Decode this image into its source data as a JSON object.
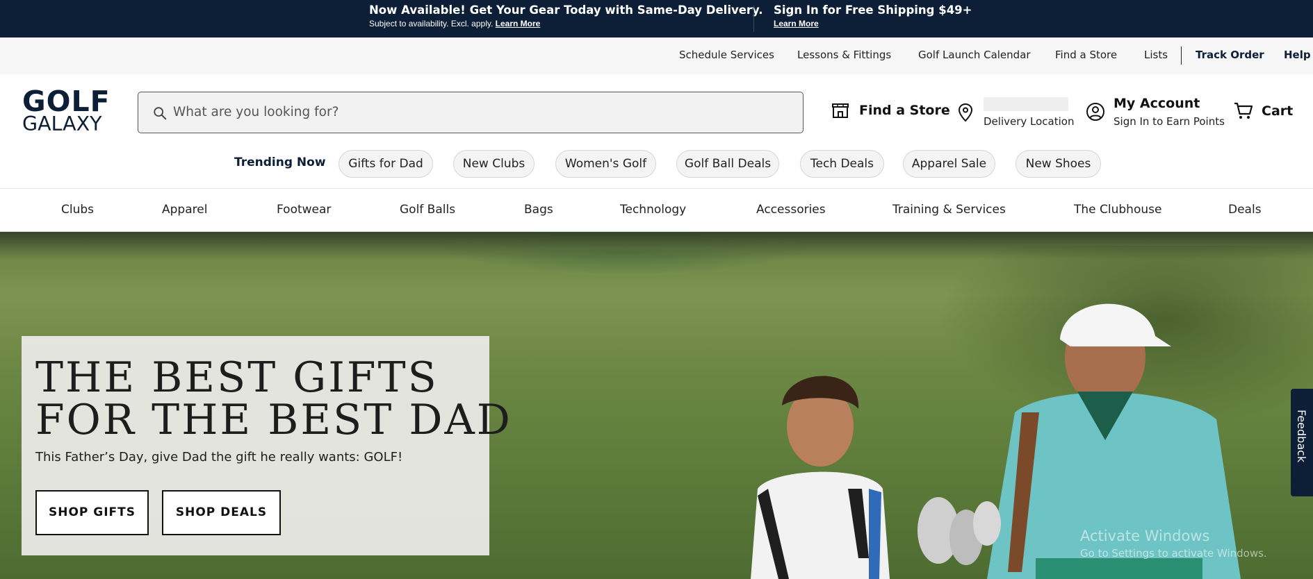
{
  "promo": {
    "left_title": "Now Available! Get Your Gear Today with Same-Day Delivery.",
    "left_sub": "Subject to availability. Excl. apply.",
    "left_link": "Learn More",
    "right_title": "Sign In for Free Shipping $49+",
    "right_link": "Learn More"
  },
  "utility_nav": [
    "Schedule Services",
    "Lessons & Fittings",
    "Golf Launch Calendar",
    "Find a Store",
    "Lists",
    "Track Order",
    "Help"
  ],
  "logo": {
    "top": "GOLF",
    "bottom": "GALAXY"
  },
  "search": {
    "placeholder": "What are you looking for?"
  },
  "header": {
    "find_store": "Find a Store",
    "delivery_location": "Delivery Location",
    "account_title": "My Account",
    "account_sub": "Sign In to Earn Points",
    "cart": "Cart"
  },
  "trending": {
    "label": "Trending Now",
    "pills": [
      "Gifts for Dad",
      "New Clubs",
      "Women's Golf",
      "Golf Ball Deals",
      "Tech Deals",
      "Apparel Sale",
      "New Shoes"
    ]
  },
  "categories": [
    "Clubs",
    "Apparel",
    "Footwear",
    "Golf Balls",
    "Bags",
    "Technology",
    "Accessories",
    "Training & Services",
    "The Clubhouse",
    "Deals"
  ],
  "hero": {
    "title_line1": "THE BEST GIFTS",
    "title_line2": "FOR THE BEST DAD",
    "subtitle": "This Father’s Day, give Dad the gift he really wants: GOLF!",
    "button1": "SHOP GIFTS",
    "button2": "SHOP DEALS"
  },
  "feedback": "Feedback",
  "watermark": {
    "line1": "Activate Windows",
    "line2": "Go to Settings to activate Windows."
  },
  "colors": {
    "navy": "#0c1f36",
    "pill_bg": "#f4f4f4",
    "card_bg": "#e8e8e4"
  }
}
